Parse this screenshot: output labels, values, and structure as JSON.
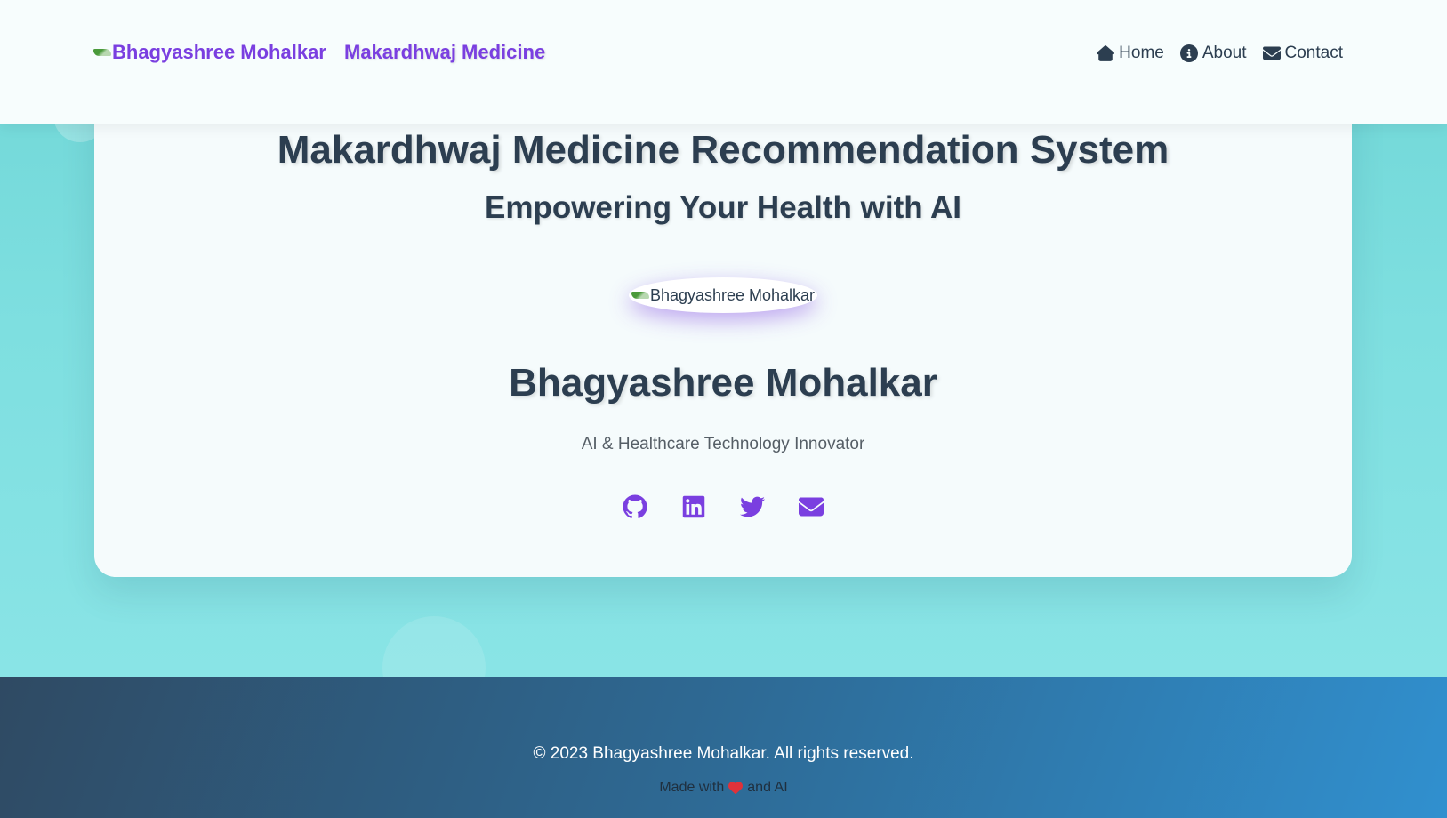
{
  "header": {
    "logo_alt": "Bhagyashree Mohalkar",
    "brand_name": "Makardhwaj Medicine",
    "nav": [
      {
        "label": "Home",
        "icon": "home-icon"
      },
      {
        "label": "About",
        "icon": "info-icon"
      },
      {
        "label": "Contact",
        "icon": "envelope-icon"
      }
    ]
  },
  "hero": {
    "title": "Makardhwaj Medicine Recommendation System",
    "subtitle": "Empowering Your Health with AI",
    "avatar_alt": "Bhagyashree Mohalkar",
    "name": "Bhagyashree Mohalkar",
    "role": "AI & Healthcare Technology Innovator",
    "socials": [
      "github-icon",
      "linkedin-icon",
      "twitter-icon",
      "envelope-icon"
    ]
  },
  "footer": {
    "copyright": "© 2023 Bhagyashree Mohalkar. All rights reserved.",
    "made_with_prefix": "Made with",
    "made_with_suffix": "and AI"
  },
  "colors": {
    "accent": "#7a3fe0",
    "text_dark": "#2c3e50",
    "background": "#7edfe0",
    "heart": "#e0323a"
  }
}
